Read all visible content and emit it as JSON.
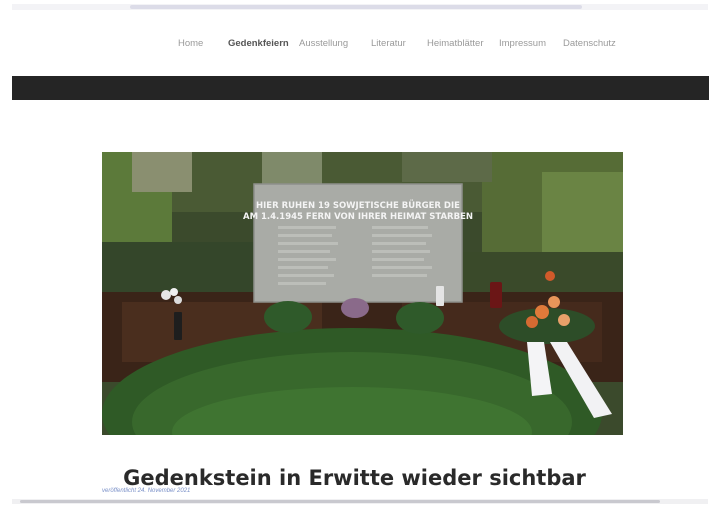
{
  "nav": {
    "items": [
      {
        "label": "Home",
        "active": false
      },
      {
        "label": "Gedenkfeiern",
        "active": true
      },
      {
        "label": "Ausstellung",
        "active": false
      },
      {
        "label": "Literatur",
        "active": false
      },
      {
        "label": "Heimatblätter",
        "active": false
      },
      {
        "label": "Impressum",
        "active": false
      },
      {
        "label": "Datenschutz",
        "active": false
      }
    ]
  },
  "photo": {
    "inscription_line1": "HIER RUHEN 19 SOWJETISCHE BÜRGER DIE",
    "inscription_line2": "AM 1.4.1945 FERN VON IHRER HEIMAT STARBEN"
  },
  "article": {
    "title": "Gedenkstein in Erwitte wieder sichtbar",
    "published": "veröffentlicht 24. November 2021"
  },
  "colors": {
    "dark_bar": "#252525",
    "nav_active": "#555555",
    "nav_inactive": "#9a9a9a",
    "published_link": "#7a90c8"
  }
}
